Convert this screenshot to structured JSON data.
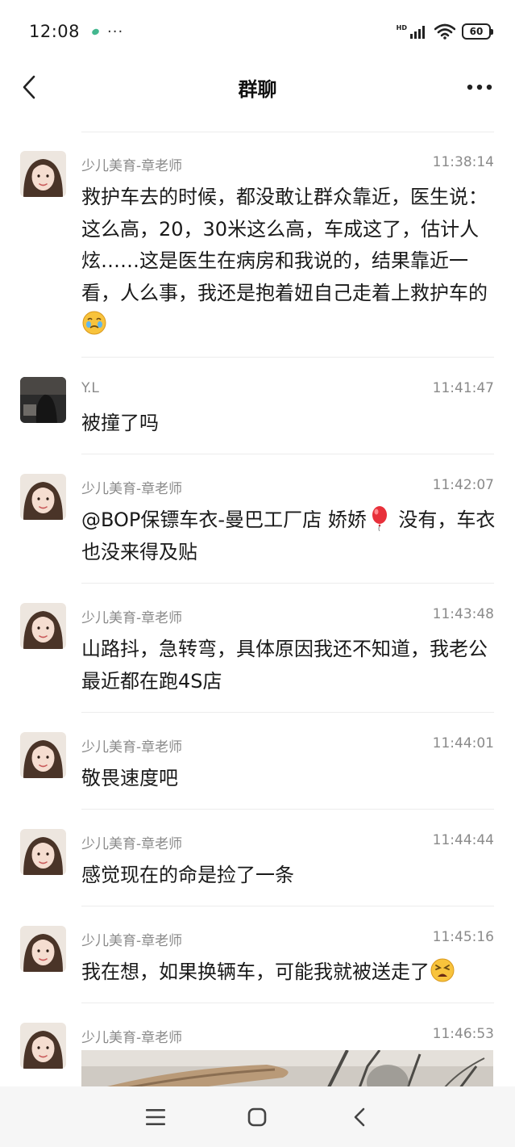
{
  "status_bar": {
    "time": "12:08",
    "dots": "···",
    "network": "HD",
    "battery": "60"
  },
  "nav": {
    "title": "群聊"
  },
  "messages": [
    {
      "sender": "少儿美育-章老师",
      "time": "11:38:14",
      "avatar": "teacher-avatar",
      "text": "救护车去的时候，都没敢让群众靠近，医生说：这么高，20，30米这么高，车成这了，估计人炫……这是医生在病房和我说的，结果靠近一看，人么事，我还是抱着妞自己走着上救护车的",
      "emoji": "crying-face-emoji"
    },
    {
      "sender": "Y.L",
      "time": "11:41:47",
      "avatar": "yl-avatar",
      "text": "被撞了吗"
    },
    {
      "sender": "少儿美育-章老师",
      "time": "11:42:07",
      "avatar": "teacher-avatar",
      "text": "@BOP保镖车衣-曼巴工厂店 娇娇",
      "text_after": " 没有，车衣也没来得及贴",
      "emoji": "balloon-emoji"
    },
    {
      "sender": "少儿美育-章老师",
      "time": "11:43:48",
      "avatar": "teacher-avatar",
      "text": "山路抖，急转弯，具体原因我还不知道，我老公最近都在跑4S店"
    },
    {
      "sender": "少儿美育-章老师",
      "time": "11:44:01",
      "avatar": "teacher-avatar",
      "text": "敬畏速度吧"
    },
    {
      "sender": "少儿美育-章老师",
      "time": "11:44:44",
      "avatar": "teacher-avatar",
      "text": "感觉现在的命是捡了一条"
    },
    {
      "sender": "少儿美育-章老师",
      "time": "11:45:16",
      "avatar": "teacher-avatar",
      "text": "我在想，如果换辆车，可能我就被送走了",
      "emoji": "tired-face-emoji"
    },
    {
      "sender": "少儿美育-章老师",
      "time": "11:46:53",
      "avatar": "teacher-avatar",
      "attachment": "photo"
    }
  ],
  "colors": {
    "meta_text": "#8a8a8a",
    "divider": "#ececec",
    "body_text": "#1a1a1a"
  }
}
